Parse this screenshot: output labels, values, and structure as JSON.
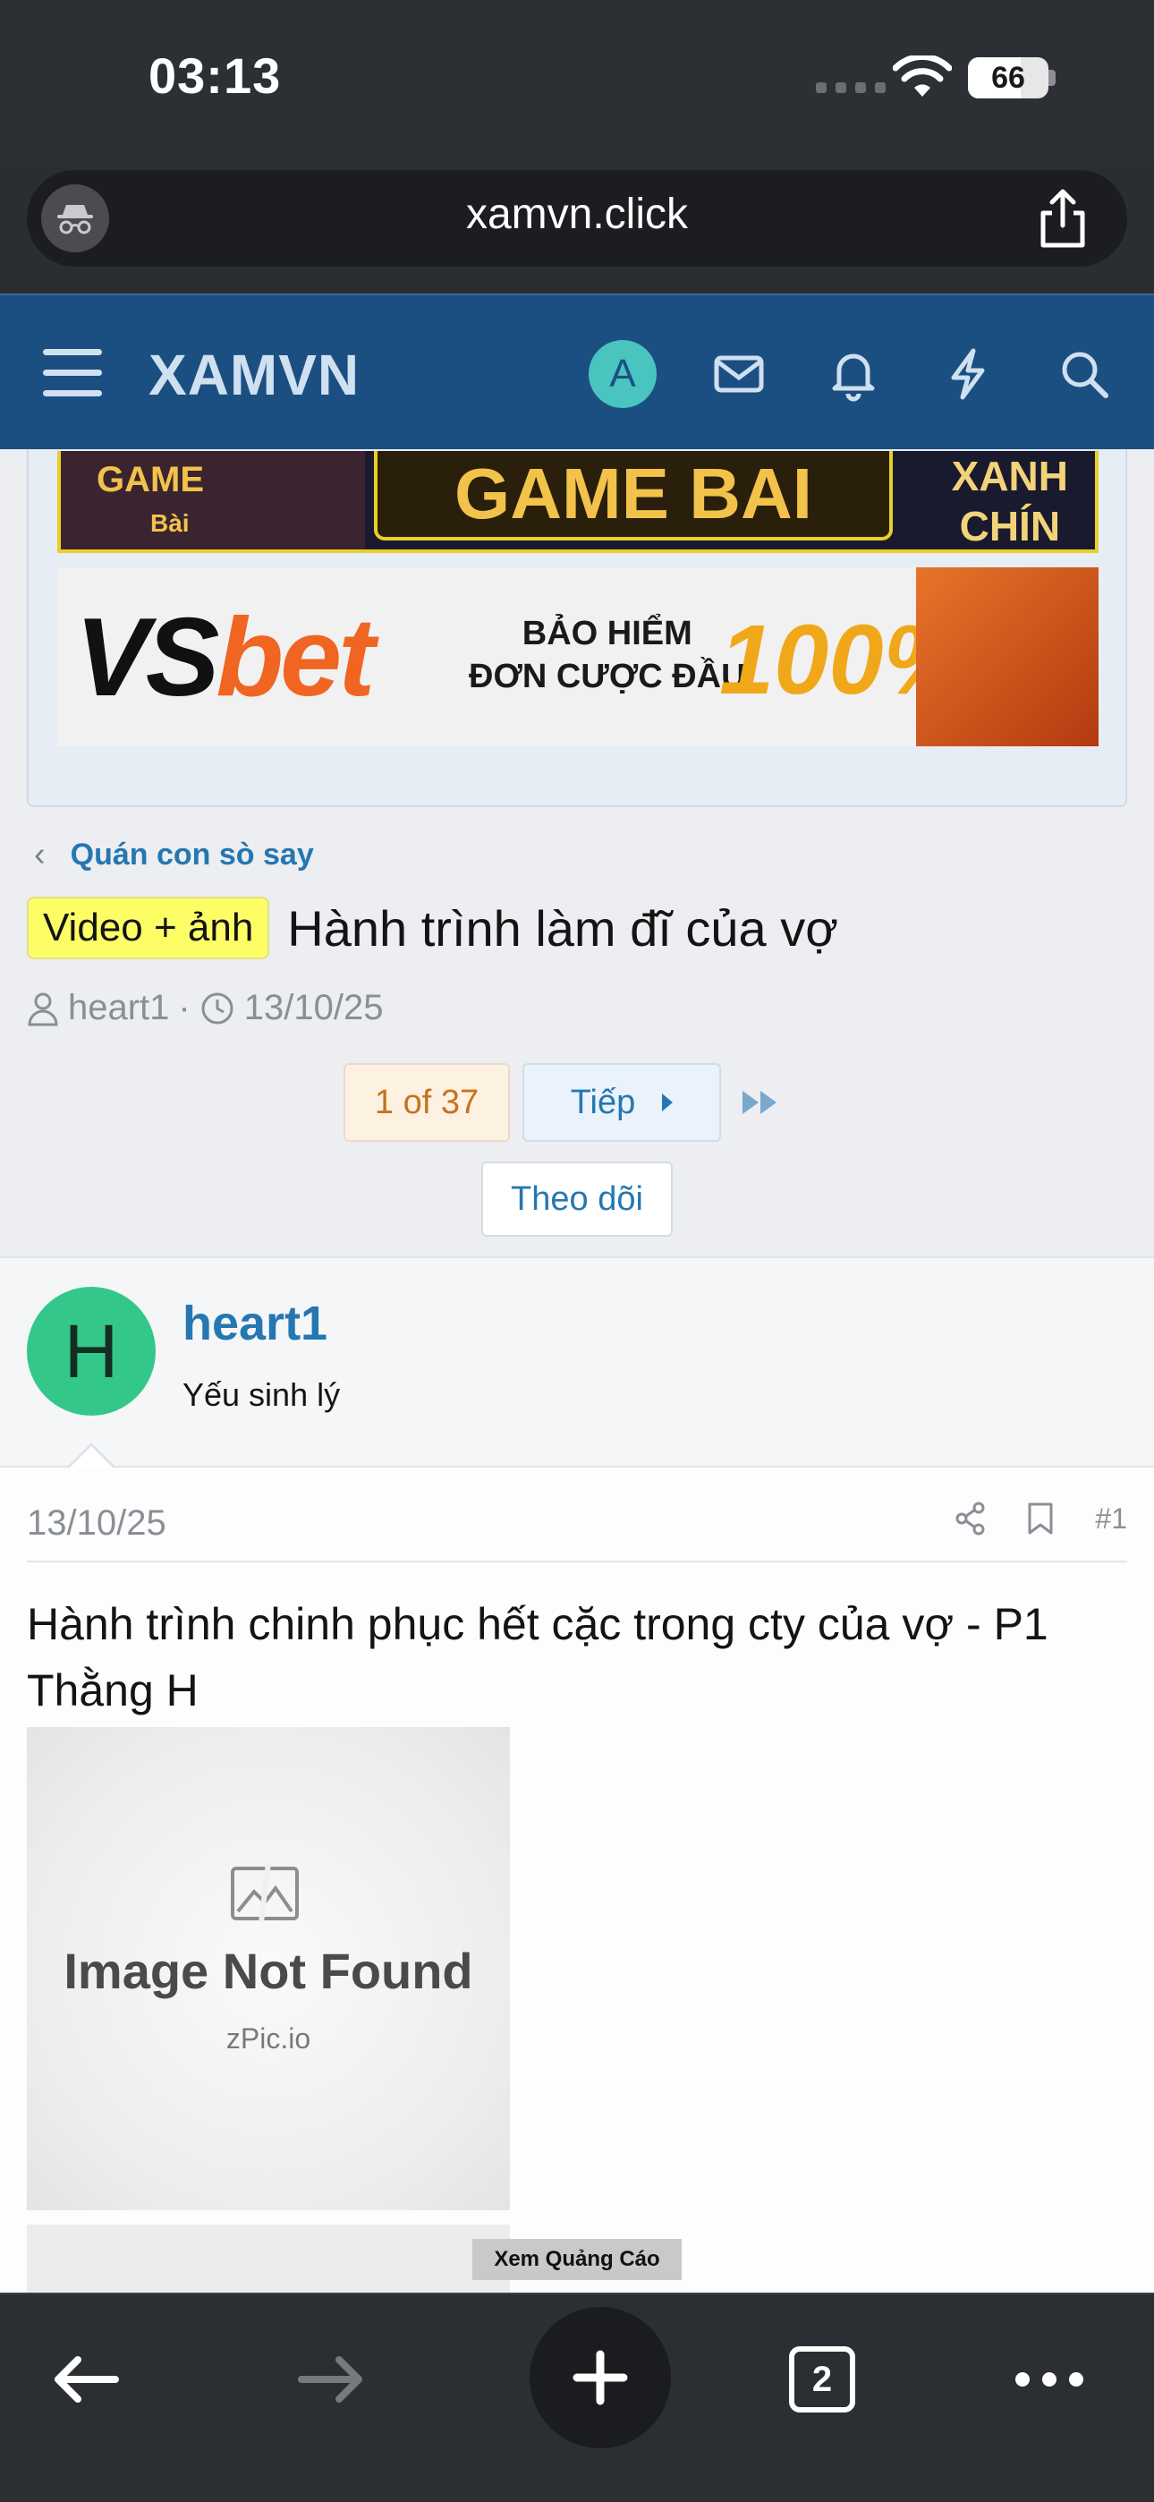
{
  "status_bar": {
    "time": "03:13",
    "battery": "66",
    "battery_level": 0.66
  },
  "browser": {
    "url": "xamvn.click",
    "tabs_count": "2"
  },
  "header": {
    "logo": "XAMVN",
    "avatar_letter": "A"
  },
  "ads": {
    "game": {
      "left_label": "GAME",
      "sub": "Bài",
      "main": "GAME BAI",
      "side_line1": "XANH",
      "side_line2": "CHÍN"
    },
    "vsbet": {
      "logo_a": "VS",
      "logo_b": "bet",
      "text_line1": "BẢO HIỂM",
      "text_line2": "ĐƠN CƯỢC ĐẦU",
      "percent": "100%"
    }
  },
  "breadcrumb": {
    "label": "Quán con sò say"
  },
  "thread": {
    "prefix": "Video + ảnh",
    "title": "Hành trình làm đĩ của vợ",
    "author": "heart1",
    "separator": "·",
    "date": "13/10/25"
  },
  "pagination": {
    "current": "1 of 37",
    "next_label": "Tiếp"
  },
  "follow_label": "Theo dõi",
  "post": {
    "avatar_letter": "H",
    "username": "heart1",
    "user_title": "Yếu sinh lý",
    "date": "13/10/25",
    "number": "#1",
    "text": "Hành trình chinh phục hết cặc trong cty của vợ - P1 Thằng H",
    "image_missing_title": "Image Not Found",
    "image_missing_sub": "zPic.io",
    "ad_tag": "Xem Quảng Cáo"
  }
}
